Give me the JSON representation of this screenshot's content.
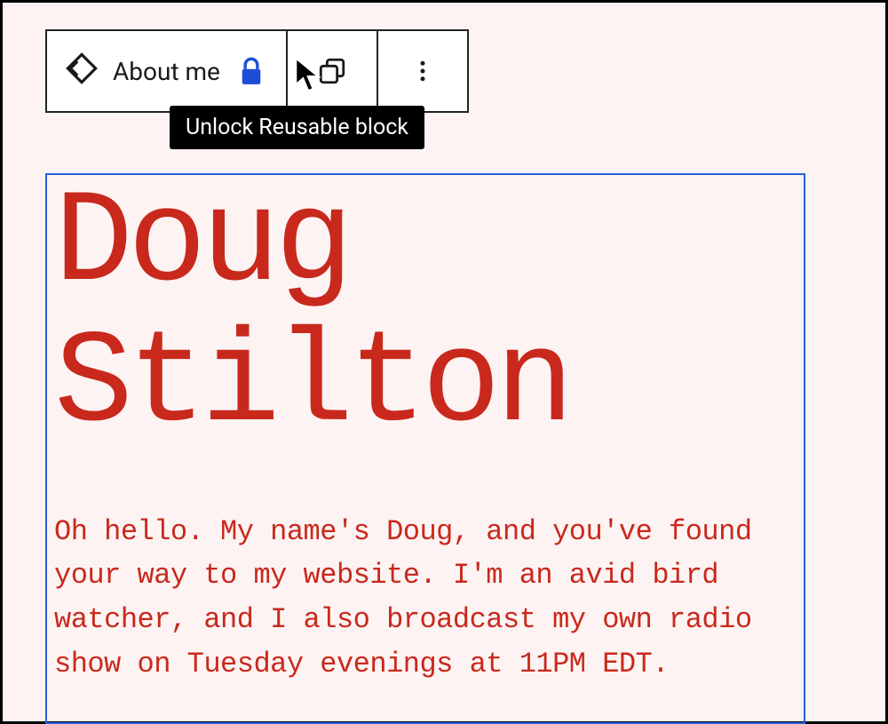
{
  "toolbar": {
    "block_name": "About me",
    "tooltip": "Unlock Reusable block"
  },
  "content": {
    "heading": "Doug Stilton",
    "paragraph": "Oh hello. My name's Doug, and you've found your way to my website. I'm an avid bird watcher, and I also broadcast my own radio show on Tuesday evenings at 11PM EDT."
  },
  "colors": {
    "accent_text": "#c8291c",
    "selection_border": "#2a5fd8",
    "lock_icon": "#1d4ed8",
    "background": "#fdf3f3"
  }
}
